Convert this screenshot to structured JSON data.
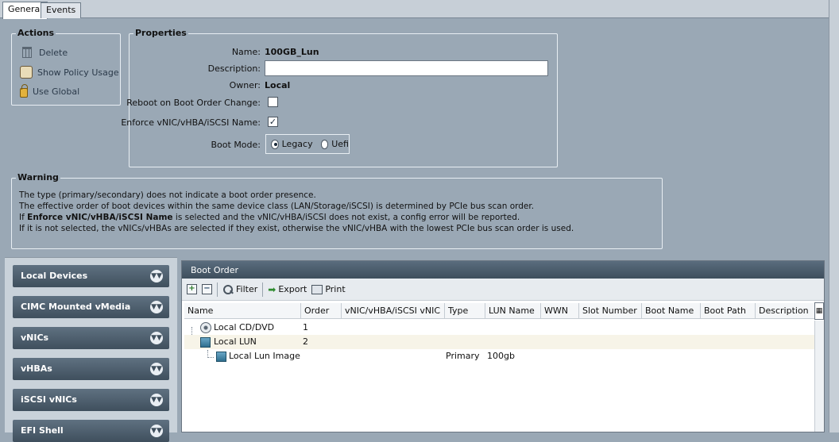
{
  "tabs": [
    {
      "label": "General",
      "active": true
    },
    {
      "label": "Events",
      "active": false
    }
  ],
  "actions": {
    "title": "Actions",
    "items": [
      {
        "label": "Delete",
        "icon": "trash-icon"
      },
      {
        "label": "Show Policy Usage",
        "icon": "scroll-icon"
      },
      {
        "label": "Use Global",
        "icon": "lock-icon"
      }
    ]
  },
  "properties": {
    "title": "Properties",
    "name_label": "Name:",
    "name_value": "100GB_Lun",
    "description_label": "Description:",
    "description_value": "",
    "owner_label": "Owner:",
    "owner_value": "Local",
    "reboot_label": "Reboot on Boot Order Change:",
    "reboot_checked": false,
    "enforce_label": "Enforce vNIC/vHBA/iSCSI Name:",
    "enforce_checked": true,
    "enforce_mark": "✓",
    "bootmode_label": "Boot Mode:",
    "bootmode_options": [
      "Legacy",
      "Uefi"
    ],
    "bootmode_selected": "Legacy"
  },
  "warning": {
    "title": "Warning",
    "line1": "The type (primary/secondary) does not indicate a boot order presence.",
    "line2": "The effective order of boot devices within the same device class (LAN/Storage/iSCSI) is determined by PCIe bus scan order.",
    "line3_pre": "If ",
    "line3_bold": "Enforce vNIC/vHBA/iSCSI Name",
    "line3_post": " is selected and the vNIC/vHBA/iSCSI does not exist, a config error will be reported.",
    "line4": "If it is not selected, the vNICs/vHBAs are selected if they exist, otherwise the vNIC/vHBA with the lowest PCIe bus scan order is used."
  },
  "accordion": [
    "Local Devices",
    "CIMC Mounted vMedia",
    "vNICs",
    "vHBAs",
    "iSCSI vNICs",
    "EFI Shell"
  ],
  "accordion_chevron": "▼▼",
  "boot_order": {
    "title": "Boot Order",
    "toolbar": {
      "add": "+",
      "remove": "−",
      "filter": "Filter",
      "export": "Export",
      "print": "Print",
      "export_arrow": "➡"
    },
    "columns": [
      "Name",
      "Order",
      "vNIC/vHBA/iSCSI vNIC",
      "Type",
      "LUN Name",
      "WWN",
      "Slot Number",
      "Boot Name",
      "Boot Path",
      "Description"
    ],
    "rows": [
      {
        "name": "Local CD/DVD",
        "order": "1",
        "type": "",
        "lun": ""
      },
      {
        "name": "Local LUN",
        "order": "2",
        "type": "",
        "lun": ""
      },
      {
        "name": "Local Lun Image",
        "order": "",
        "type": "Primary",
        "lun": "100gb"
      }
    ],
    "column_menu_icon": "▦"
  }
}
